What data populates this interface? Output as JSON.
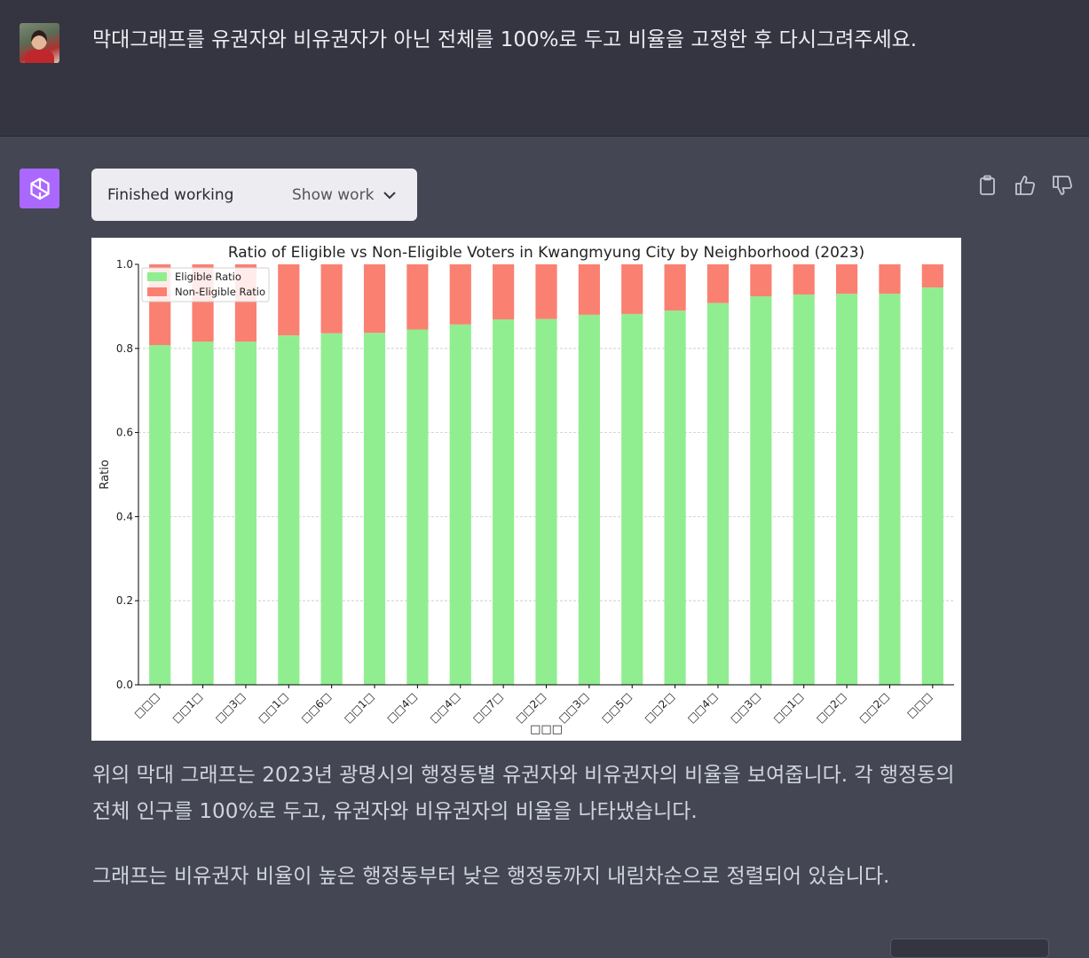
{
  "user_message": "막대그래프를 유권자와 비유권자가 아닌 전체를 100%로 두고 비율을 고정한 후 다시그려주세요.",
  "work": {
    "status": "Finished working",
    "toggle_label": "Show work"
  },
  "icons": {
    "avatar": "user-avatar",
    "assistant": "openai-logo-icon",
    "copy": "clipboard-icon",
    "like": "thumbs-up-icon",
    "dislike": "thumbs-down-icon",
    "expand": "chevron-down-icon"
  },
  "colors": {
    "eligible": "#90ee90",
    "non_eligible": "#fa8072",
    "assistant_accent": "#ab68ff"
  },
  "chart_data": {
    "type": "bar",
    "stacked": true,
    "title": "Ratio of Eligible vs Non-Eligible Voters in Kwangmyung City by Neighborhood (2023)",
    "xlabel": "□□□",
    "ylabel": "Ratio",
    "ylim": [
      0,
      1.0
    ],
    "yticks": [
      "0.0",
      "0.2",
      "0.4",
      "0.6",
      "0.8",
      "1.0"
    ],
    "grid": "horizontal dashed",
    "legend_position": "top-left",
    "categories": [
      "□□□",
      "□□1□",
      "□□3□",
      "□□1□",
      "□□6□",
      "□□1□",
      "□□4□",
      "□□4□",
      "□□7□",
      "□□2□",
      "□□3□",
      "□□5□",
      "□□2□",
      "□□4□",
      "□□3□",
      "□□1□",
      "□□2□",
      "□□2□",
      "□□□"
    ],
    "series": [
      {
        "name": "Eligible Ratio",
        "values": [
          0.808,
          0.816,
          0.816,
          0.831,
          0.836,
          0.837,
          0.845,
          0.857,
          0.869,
          0.87,
          0.88,
          0.882,
          0.89,
          0.908,
          0.924,
          0.928,
          0.93,
          0.93,
          0.945
        ]
      },
      {
        "name": "Non-Eligible Ratio",
        "values": [
          0.192,
          0.184,
          0.184,
          0.169,
          0.164,
          0.163,
          0.155,
          0.143,
          0.131,
          0.13,
          0.12,
          0.118,
          0.11,
          0.092,
          0.076,
          0.072,
          0.07,
          0.07,
          0.055
        ]
      }
    ]
  },
  "assistant_paragraphs": [
    "위의 막대 그래프는 2023년 광명시의 행정동별 유권자와 비유권자의 비율을 보여줍니다. 각 행정동의 전체 인구를 100%로 두고, 유권자와 비유권자의 비율을 나타냈습니다.",
    "그래프는 비유권자 비율이 높은 행정동부터 낮은 행정동까지 내림차순으로 정렬되어 있습니다."
  ]
}
